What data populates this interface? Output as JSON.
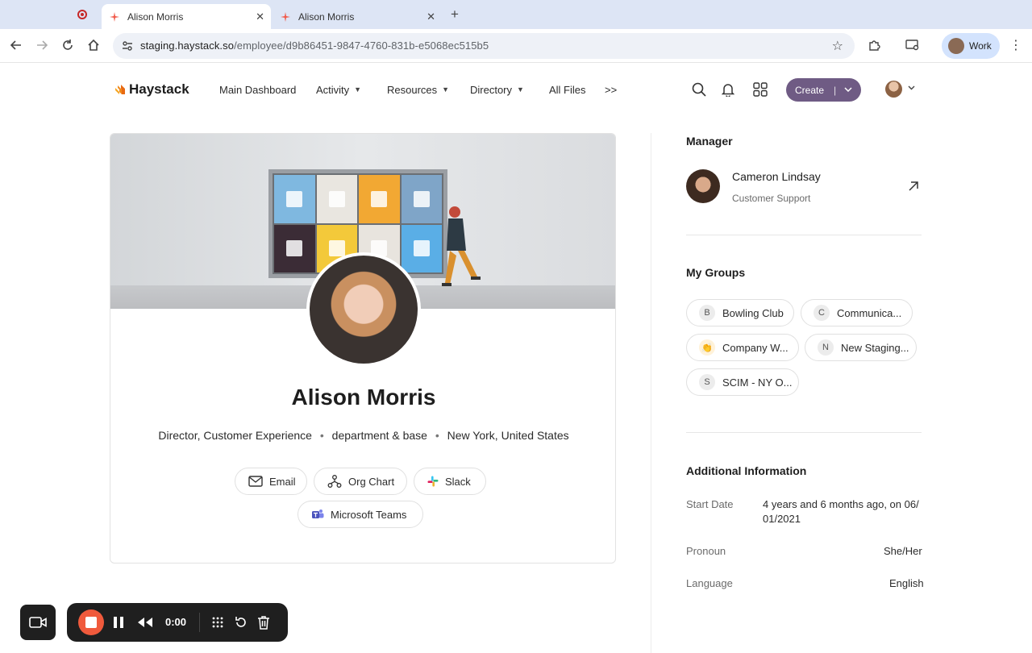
{
  "browser": {
    "tabs": [
      {
        "title": "Alison Morris",
        "active": true
      },
      {
        "title": "Alison Morris",
        "active": false
      }
    ],
    "close_glyph": "✕",
    "new_tab_glyph": "+",
    "url_host": "staging.haystack.so",
    "url_path": "/employee/d9b86451-9847-4760-831b-e5068ec515b5",
    "profile_label": "Work"
  },
  "app": {
    "brand": "Haystack",
    "nav": [
      {
        "label": "Main Dashboard",
        "has_menu": false
      },
      {
        "label": "Activity",
        "has_menu": true
      },
      {
        "label": "Resources",
        "has_menu": true
      },
      {
        "label": "Directory",
        "has_menu": true
      },
      {
        "label": "All Files",
        "has_menu": false
      }
    ],
    "nav_more": ">>",
    "create_label": "Create",
    "create_sep": "|",
    "accent": "#6f5b84"
  },
  "profile": {
    "name": "Alison Morris",
    "title": "Director, Customer Experience",
    "department": "department & base",
    "location": "New York, United States",
    "meta_sep": "•",
    "actions": {
      "email": "Email",
      "org_chart": "Org Chart",
      "slack": "Slack",
      "teams": "Microsoft Teams"
    }
  },
  "manager": {
    "heading": "Manager",
    "name": "Cameron Lindsay",
    "role": "Customer Support"
  },
  "groups": {
    "heading": "My Groups",
    "items": [
      {
        "initial": "B",
        "label": "Bowling Club"
      },
      {
        "initial": "C",
        "label": "Communica..."
      },
      {
        "initial": "👏",
        "label": "Company W..."
      },
      {
        "initial": "N",
        "label": "New Staging..."
      },
      {
        "initial": "S",
        "label": "SCIM - NY O..."
      }
    ]
  },
  "additional": {
    "heading": "Additional Information",
    "start_date_label": "Start Date",
    "start_date_line1": "4 years and 6 months ago, on 06/",
    "start_date_line2": "01/2021",
    "pronoun_label": "Pronoun",
    "pronoun_value": "She/Her",
    "language_label": "Language",
    "language_value": "English"
  },
  "recorder": {
    "time": "0:00",
    "stop_color": "#f05a3c"
  }
}
